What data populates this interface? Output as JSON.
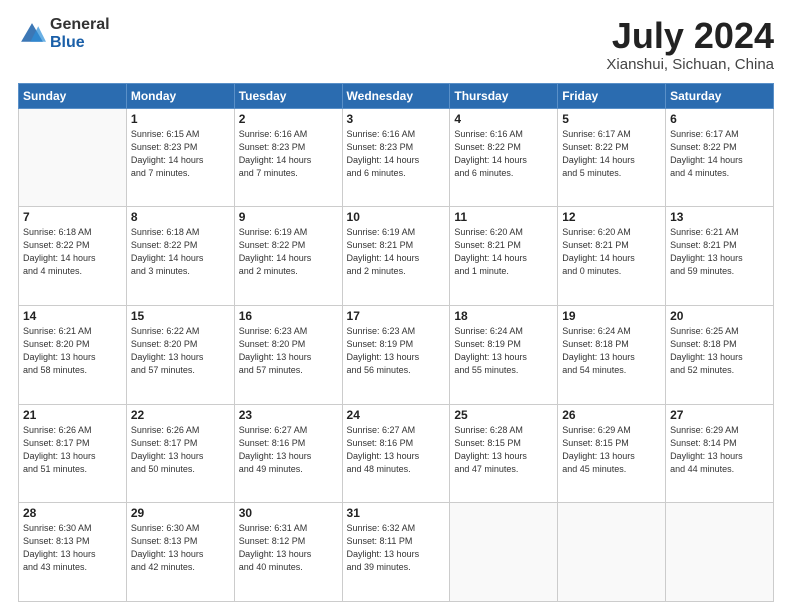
{
  "header": {
    "logo_general": "General",
    "logo_blue": "Blue",
    "main_title": "July 2024",
    "subtitle": "Xianshui, Sichuan, China"
  },
  "calendar": {
    "headers": [
      "Sunday",
      "Monday",
      "Tuesday",
      "Wednesday",
      "Thursday",
      "Friday",
      "Saturday"
    ],
    "weeks": [
      [
        {
          "day": "",
          "info": ""
        },
        {
          "day": "1",
          "info": "Sunrise: 6:15 AM\nSunset: 8:23 PM\nDaylight: 14 hours\nand 7 minutes."
        },
        {
          "day": "2",
          "info": "Sunrise: 6:16 AM\nSunset: 8:23 PM\nDaylight: 14 hours\nand 7 minutes."
        },
        {
          "day": "3",
          "info": "Sunrise: 6:16 AM\nSunset: 8:23 PM\nDaylight: 14 hours\nand 6 minutes."
        },
        {
          "day": "4",
          "info": "Sunrise: 6:16 AM\nSunset: 8:22 PM\nDaylight: 14 hours\nand 6 minutes."
        },
        {
          "day": "5",
          "info": "Sunrise: 6:17 AM\nSunset: 8:22 PM\nDaylight: 14 hours\nand 5 minutes."
        },
        {
          "day": "6",
          "info": "Sunrise: 6:17 AM\nSunset: 8:22 PM\nDaylight: 14 hours\nand 4 minutes."
        }
      ],
      [
        {
          "day": "7",
          "info": "Sunrise: 6:18 AM\nSunset: 8:22 PM\nDaylight: 14 hours\nand 4 minutes."
        },
        {
          "day": "8",
          "info": "Sunrise: 6:18 AM\nSunset: 8:22 PM\nDaylight: 14 hours\nand 3 minutes."
        },
        {
          "day": "9",
          "info": "Sunrise: 6:19 AM\nSunset: 8:22 PM\nDaylight: 14 hours\nand 2 minutes."
        },
        {
          "day": "10",
          "info": "Sunrise: 6:19 AM\nSunset: 8:21 PM\nDaylight: 14 hours\nand 2 minutes."
        },
        {
          "day": "11",
          "info": "Sunrise: 6:20 AM\nSunset: 8:21 PM\nDaylight: 14 hours\nand 1 minute."
        },
        {
          "day": "12",
          "info": "Sunrise: 6:20 AM\nSunset: 8:21 PM\nDaylight: 14 hours\nand 0 minutes."
        },
        {
          "day": "13",
          "info": "Sunrise: 6:21 AM\nSunset: 8:21 PM\nDaylight: 13 hours\nand 59 minutes."
        }
      ],
      [
        {
          "day": "14",
          "info": "Sunrise: 6:21 AM\nSunset: 8:20 PM\nDaylight: 13 hours\nand 58 minutes."
        },
        {
          "day": "15",
          "info": "Sunrise: 6:22 AM\nSunset: 8:20 PM\nDaylight: 13 hours\nand 57 minutes."
        },
        {
          "day": "16",
          "info": "Sunrise: 6:23 AM\nSunset: 8:20 PM\nDaylight: 13 hours\nand 57 minutes."
        },
        {
          "day": "17",
          "info": "Sunrise: 6:23 AM\nSunset: 8:19 PM\nDaylight: 13 hours\nand 56 minutes."
        },
        {
          "day": "18",
          "info": "Sunrise: 6:24 AM\nSunset: 8:19 PM\nDaylight: 13 hours\nand 55 minutes."
        },
        {
          "day": "19",
          "info": "Sunrise: 6:24 AM\nSunset: 8:18 PM\nDaylight: 13 hours\nand 54 minutes."
        },
        {
          "day": "20",
          "info": "Sunrise: 6:25 AM\nSunset: 8:18 PM\nDaylight: 13 hours\nand 52 minutes."
        }
      ],
      [
        {
          "day": "21",
          "info": "Sunrise: 6:26 AM\nSunset: 8:17 PM\nDaylight: 13 hours\nand 51 minutes."
        },
        {
          "day": "22",
          "info": "Sunrise: 6:26 AM\nSunset: 8:17 PM\nDaylight: 13 hours\nand 50 minutes."
        },
        {
          "day": "23",
          "info": "Sunrise: 6:27 AM\nSunset: 8:16 PM\nDaylight: 13 hours\nand 49 minutes."
        },
        {
          "day": "24",
          "info": "Sunrise: 6:27 AM\nSunset: 8:16 PM\nDaylight: 13 hours\nand 48 minutes."
        },
        {
          "day": "25",
          "info": "Sunrise: 6:28 AM\nSunset: 8:15 PM\nDaylight: 13 hours\nand 47 minutes."
        },
        {
          "day": "26",
          "info": "Sunrise: 6:29 AM\nSunset: 8:15 PM\nDaylight: 13 hours\nand 45 minutes."
        },
        {
          "day": "27",
          "info": "Sunrise: 6:29 AM\nSunset: 8:14 PM\nDaylight: 13 hours\nand 44 minutes."
        }
      ],
      [
        {
          "day": "28",
          "info": "Sunrise: 6:30 AM\nSunset: 8:13 PM\nDaylight: 13 hours\nand 43 minutes."
        },
        {
          "day": "29",
          "info": "Sunrise: 6:30 AM\nSunset: 8:13 PM\nDaylight: 13 hours\nand 42 minutes."
        },
        {
          "day": "30",
          "info": "Sunrise: 6:31 AM\nSunset: 8:12 PM\nDaylight: 13 hours\nand 40 minutes."
        },
        {
          "day": "31",
          "info": "Sunrise: 6:32 AM\nSunset: 8:11 PM\nDaylight: 13 hours\nand 39 minutes."
        },
        {
          "day": "",
          "info": ""
        },
        {
          "day": "",
          "info": ""
        },
        {
          "day": "",
          "info": ""
        }
      ]
    ]
  }
}
